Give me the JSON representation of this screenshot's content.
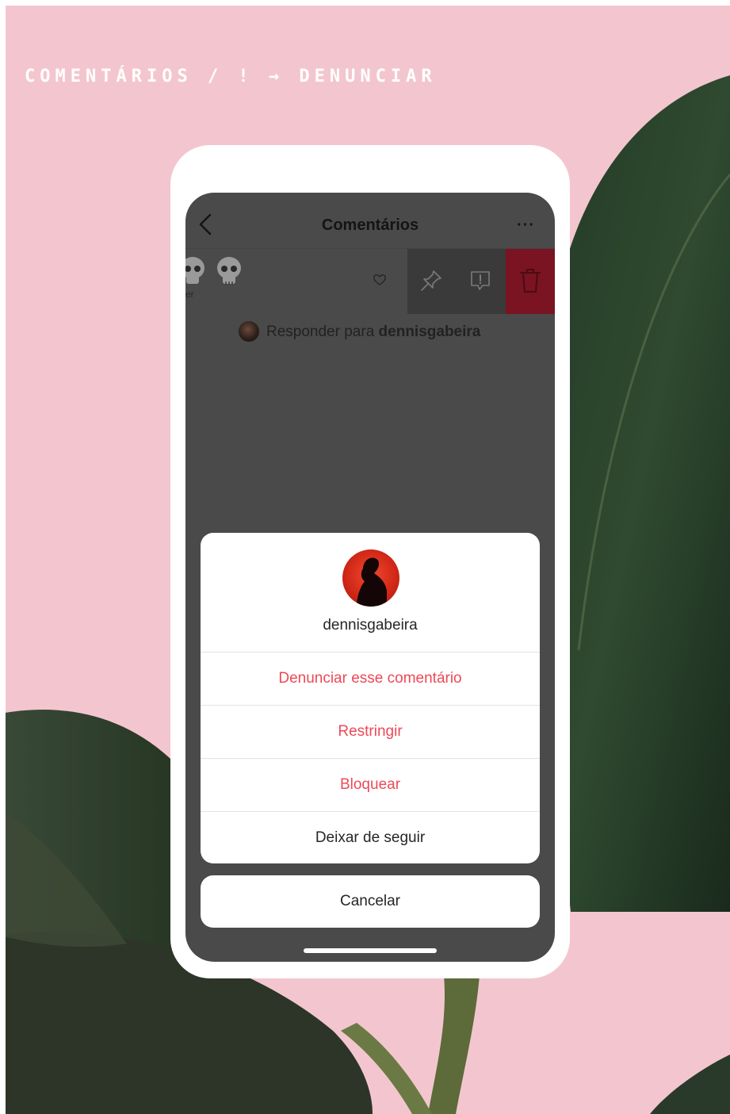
{
  "caption": "COMENTÁRIOS / ! → DENUNCIAR",
  "header": {
    "title": "Comentários",
    "more_label": "···"
  },
  "comment": {
    "partial_text": "er",
    "icons": [
      "skull-icon",
      "skull-icon",
      "heart-icon",
      "pin-icon",
      "report-icon",
      "trash-icon"
    ]
  },
  "reply": {
    "prefix": "Responder para ",
    "username": "dennisgabeira"
  },
  "sheet": {
    "username": "dennisgabeira",
    "options": [
      {
        "label": "Denunciar esse comentário",
        "color": "#ed4956"
      },
      {
        "label": "Restringir",
        "color": "#ed4956"
      },
      {
        "label": "Bloquear",
        "color": "#ed4956"
      },
      {
        "label": "Deixar de seguir",
        "color": "#262626"
      }
    ],
    "cancel_label": "Cancelar"
  },
  "colors": {
    "background": "#f3c6cf",
    "overlay": "#4a4a4a",
    "destructive": "#ed4956",
    "delete_action": "#7a1322"
  }
}
